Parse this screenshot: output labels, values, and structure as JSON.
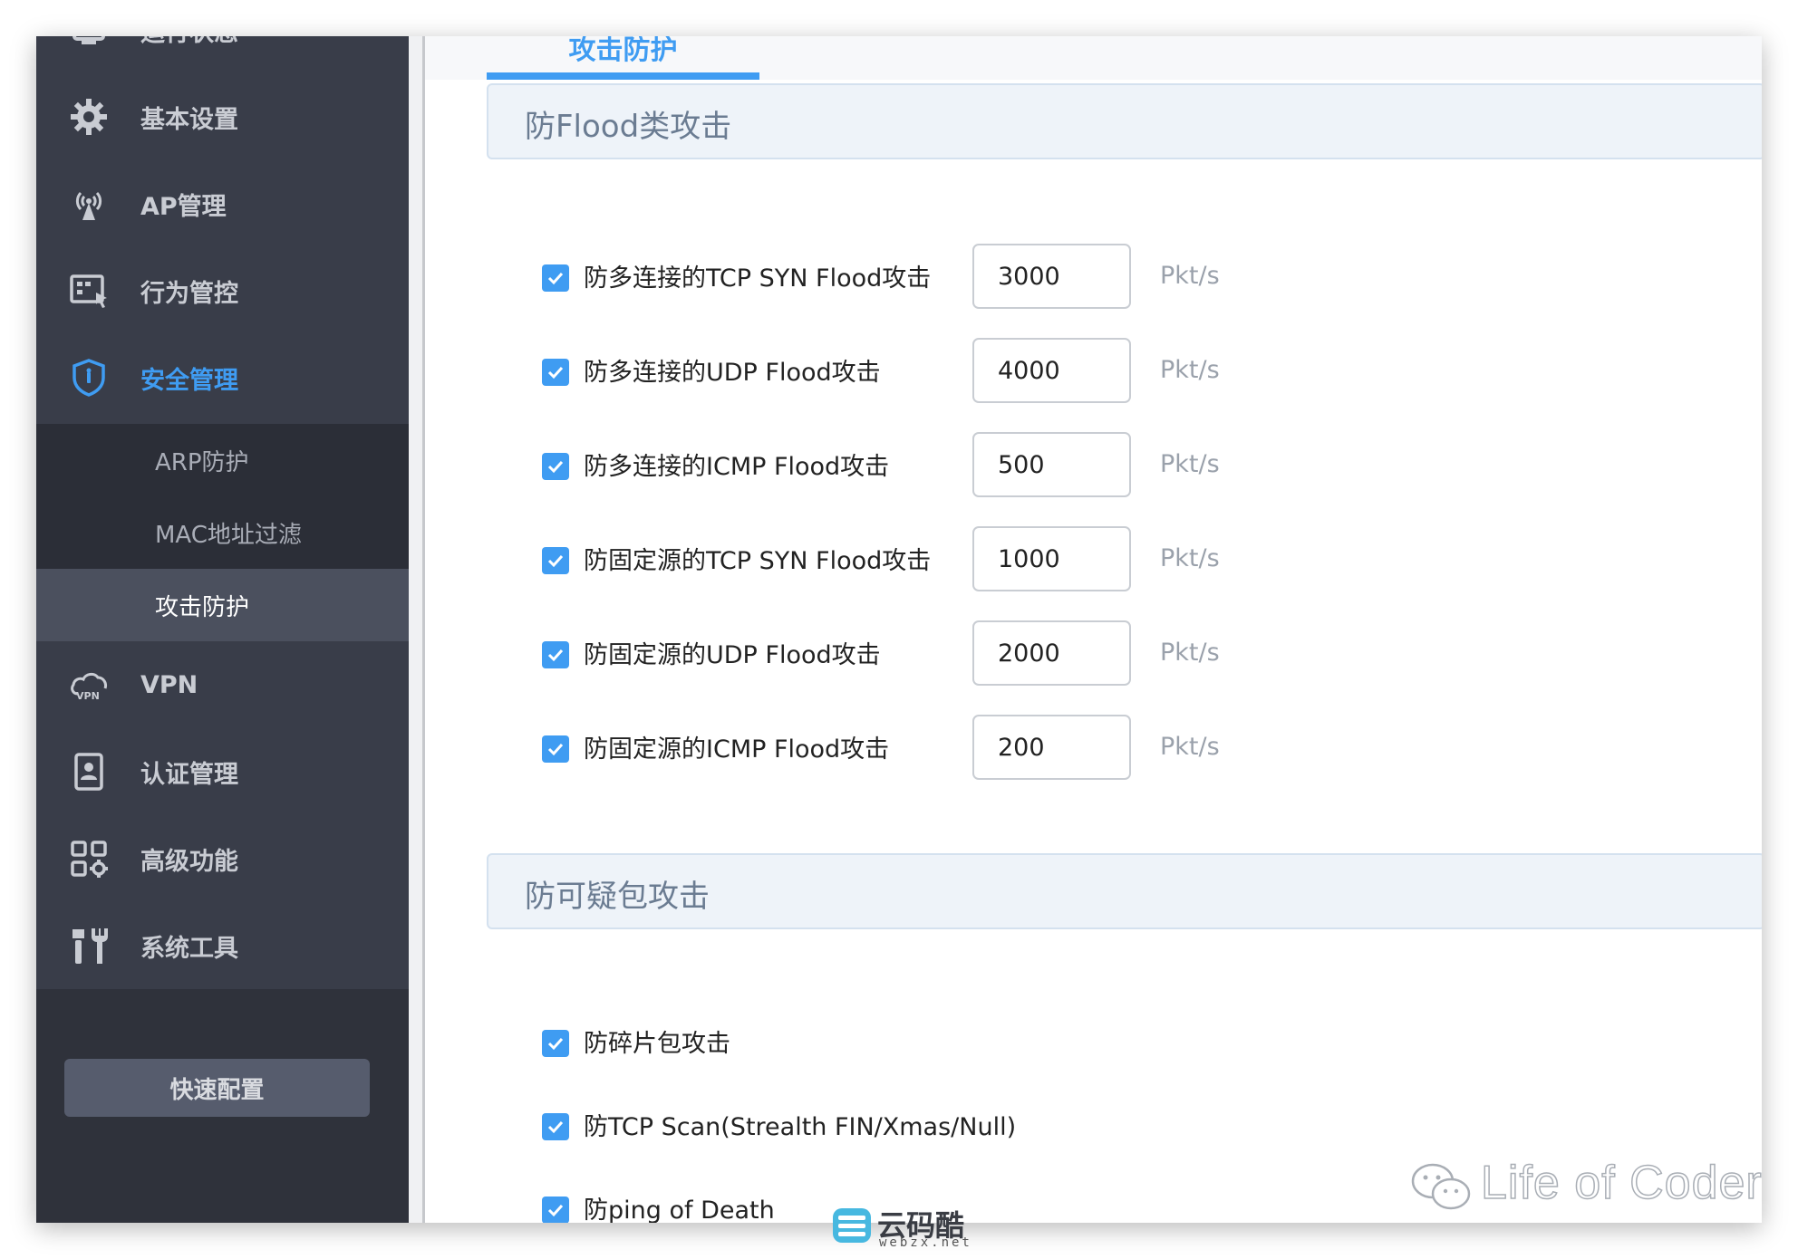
{
  "sidebar": {
    "items": [
      {
        "label": "运行状态",
        "icon": "monitor-icon"
      },
      {
        "label": "基本设置",
        "icon": "gear-icon"
      },
      {
        "label": "AP管理",
        "icon": "antenna-icon"
      },
      {
        "label": "行为管控",
        "icon": "control-panel-icon"
      },
      {
        "label": "安全管理",
        "icon": "shield-icon"
      },
      {
        "label": "VPN",
        "icon": "vpn-cloud-icon"
      },
      {
        "label": "认证管理",
        "icon": "badge-icon"
      },
      {
        "label": "高级功能",
        "icon": "grid-gear-icon"
      },
      {
        "label": "系统工具",
        "icon": "tools-icon"
      }
    ],
    "submenu": [
      "ARP防护",
      "MAC地址过滤",
      "攻击防护"
    ],
    "quick_config": "快速配置"
  },
  "tab": {
    "label": "攻击防护"
  },
  "flood_section": {
    "title": "防Flood类攻击",
    "rows": [
      {
        "label": "防多连接的TCP SYN Flood攻击",
        "value": "3000",
        "unit": "Pkt/s"
      },
      {
        "label": "防多连接的UDP Flood攻击",
        "value": "4000",
        "unit": "Pkt/s"
      },
      {
        "label": "防多连接的ICMP Flood攻击",
        "value": "500",
        "unit": "Pkt/s"
      },
      {
        "label": "防固定源的TCP SYN Flood攻击",
        "value": "1000",
        "unit": "Pkt/s"
      },
      {
        "label": "防固定源的UDP Flood攻击",
        "value": "2000",
        "unit": "Pkt/s"
      },
      {
        "label": "防固定源的ICMP Flood攻击",
        "value": "200",
        "unit": "Pkt/s"
      }
    ]
  },
  "suspicious_section": {
    "title": "防可疑包攻击",
    "rows": [
      {
        "label": "防碎片包攻击"
      },
      {
        "label": "防TCP Scan(Strealth FIN/Xmas/Null)"
      },
      {
        "label": "防ping of Death"
      }
    ]
  },
  "watermarks": {
    "wechat_text": "Life of Coder",
    "site_name": "云码酷",
    "site_domain": "webzx.net"
  },
  "colors": {
    "accent": "#3f9cf2",
    "sidebar_bg": "#393d49"
  }
}
